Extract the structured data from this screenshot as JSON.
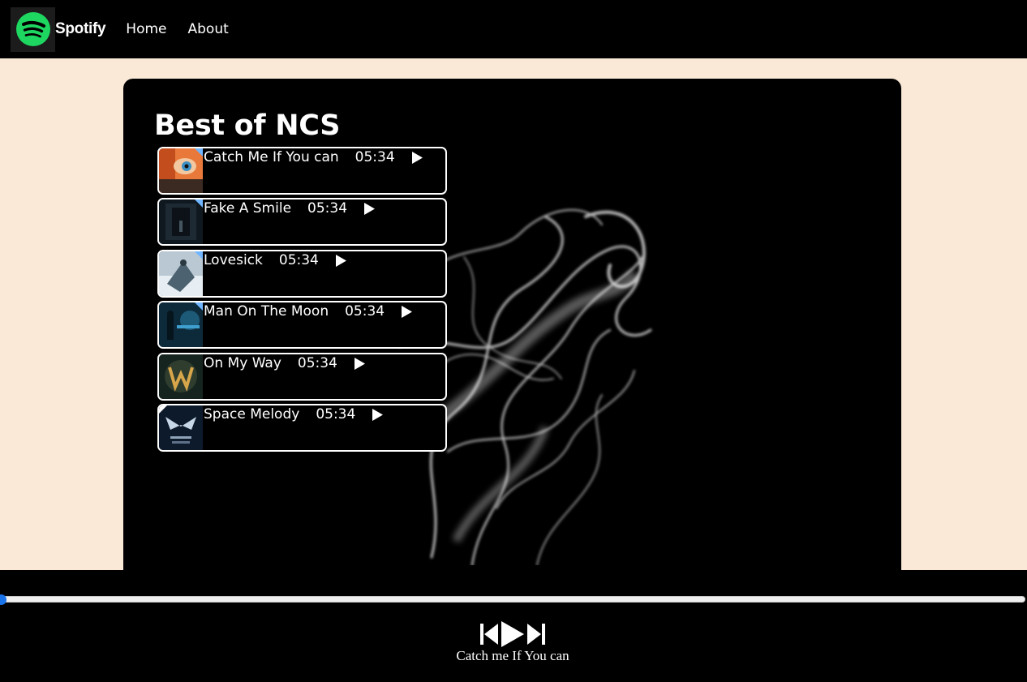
{
  "nav": {
    "brand": "Spotify",
    "links": [
      "Home",
      "About"
    ]
  },
  "playlist": {
    "title": "Best of NCS",
    "songs": [
      {
        "name": "Catch Me If You can",
        "duration": "05:34"
      },
      {
        "name": "Fake A Smile",
        "duration": "05:34"
      },
      {
        "name": "Lovesick",
        "duration": "05:34"
      },
      {
        "name": "Man On The Moon",
        "duration": "05:34"
      },
      {
        "name": "On My Way",
        "duration": "05:34"
      },
      {
        "name": "Space Melody",
        "duration": "05:34"
      }
    ]
  },
  "player": {
    "now_playing": "Catch me If You can",
    "progress": 0
  },
  "colors": {
    "page_bg": "#F9E9D6",
    "panel_bg": "#000000",
    "brand_green": "#1ED760",
    "slider_accent": "#1A73E8"
  },
  "icons": [
    "spotify-logo",
    "play-icon",
    "previous-icon",
    "next-icon"
  ]
}
